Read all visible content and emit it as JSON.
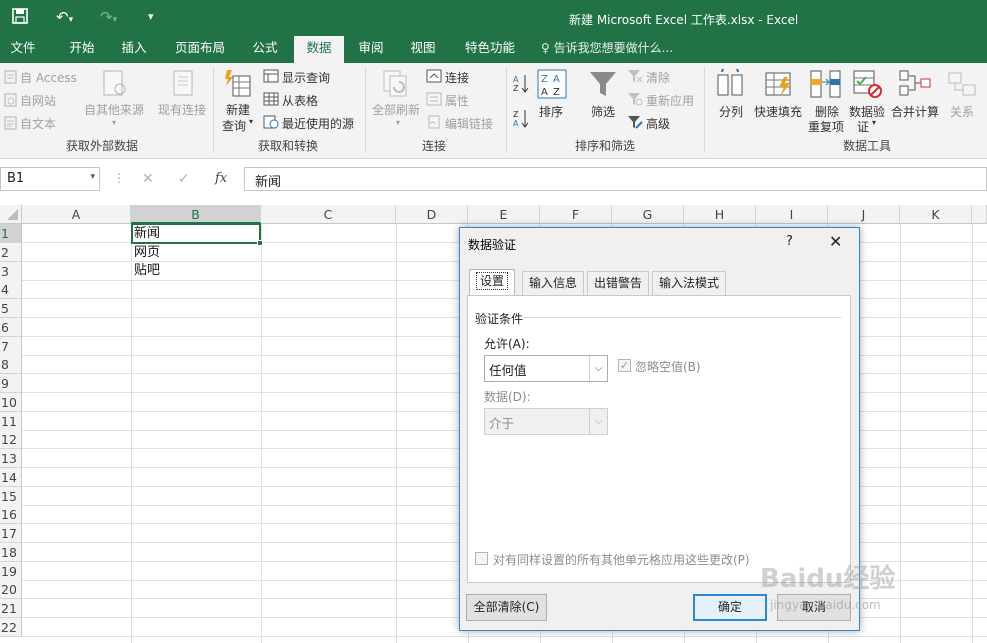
{
  "window": {
    "title": "新建 Microsoft Excel 工作表.xlsx - Excel",
    "accent": "#217346"
  },
  "tabs": {
    "items": [
      "文件",
      "开始",
      "插入",
      "页面布局",
      "公式",
      "数据",
      "审阅",
      "视图",
      "特色功能"
    ],
    "active": "数据",
    "tell_me": "告诉我您想要做什么..."
  },
  "ribbon": {
    "external": {
      "access": "自 Access",
      "web": "自网站",
      "text": "自文本",
      "other_sources": "自其他来源",
      "existing": "现有连接",
      "group": "获取外部数据"
    },
    "transform": {
      "new_query_1": "新建",
      "new_query_2": "查询",
      "show_queries": "显示查询",
      "from_table": "从表格",
      "recent_sources": "最近使用的源",
      "group": "获取和转换"
    },
    "connections": {
      "refresh_all": "全部刷新",
      "connections": "连接",
      "properties": "属性",
      "edit_links": "编辑链接",
      "group": "连接"
    },
    "sort_filter": {
      "sort": "排序",
      "filter": "筛选",
      "clear": "清除",
      "reapply": "重新应用",
      "advanced": "高级",
      "group": "排序和筛选"
    },
    "tools": {
      "split": "分列",
      "flash_fill": "快速填充",
      "remove_dup_1": "删除",
      "remove_dup_2": "重复项",
      "validation_1": "数据验",
      "validation_2": "证",
      "consolidate": "合并计算",
      "relationships": "关系",
      "group": "数据工具"
    }
  },
  "formula_bar": {
    "name_box": "B1",
    "cancel": "✕",
    "enter": "✓",
    "fx": "fx",
    "value": "新闻"
  },
  "grid": {
    "columns": [
      "A",
      "B",
      "C",
      "D",
      "E",
      "F",
      "G",
      "H",
      "I",
      "J",
      "K"
    ],
    "rows": [
      "1",
      "2",
      "3",
      "4",
      "5",
      "6",
      "7",
      "8",
      "9",
      "10",
      "11",
      "12",
      "13",
      "14",
      "15",
      "16",
      "17",
      "18",
      "19",
      "20",
      "21",
      "22"
    ],
    "selected_cell": "B1",
    "cells": {
      "B1": "新闻",
      "B2": "网页",
      "B3": "贴吧"
    }
  },
  "dialog": {
    "title": "数据验证",
    "help": "?",
    "close": "✕",
    "tabs": [
      "设置",
      "输入信息",
      "出错警告",
      "输入法模式"
    ],
    "active_tab": "设置",
    "section": "验证条件",
    "allow_label": "允许(A):",
    "allow_value": "任何值",
    "ignore_blank": "忽略空值(B)",
    "ignore_blank_checked": true,
    "data_label": "数据(D):",
    "data_value": "介于",
    "apply_all": "对有同样设置的所有其他单元格应用这些更改(P)",
    "apply_all_checked": false,
    "clear_all": "全部清除(C)",
    "ok": "确定",
    "cancel": "取消"
  },
  "watermark": {
    "brand": "Baidu经验",
    "url": "jingyan.baidu.com"
  }
}
